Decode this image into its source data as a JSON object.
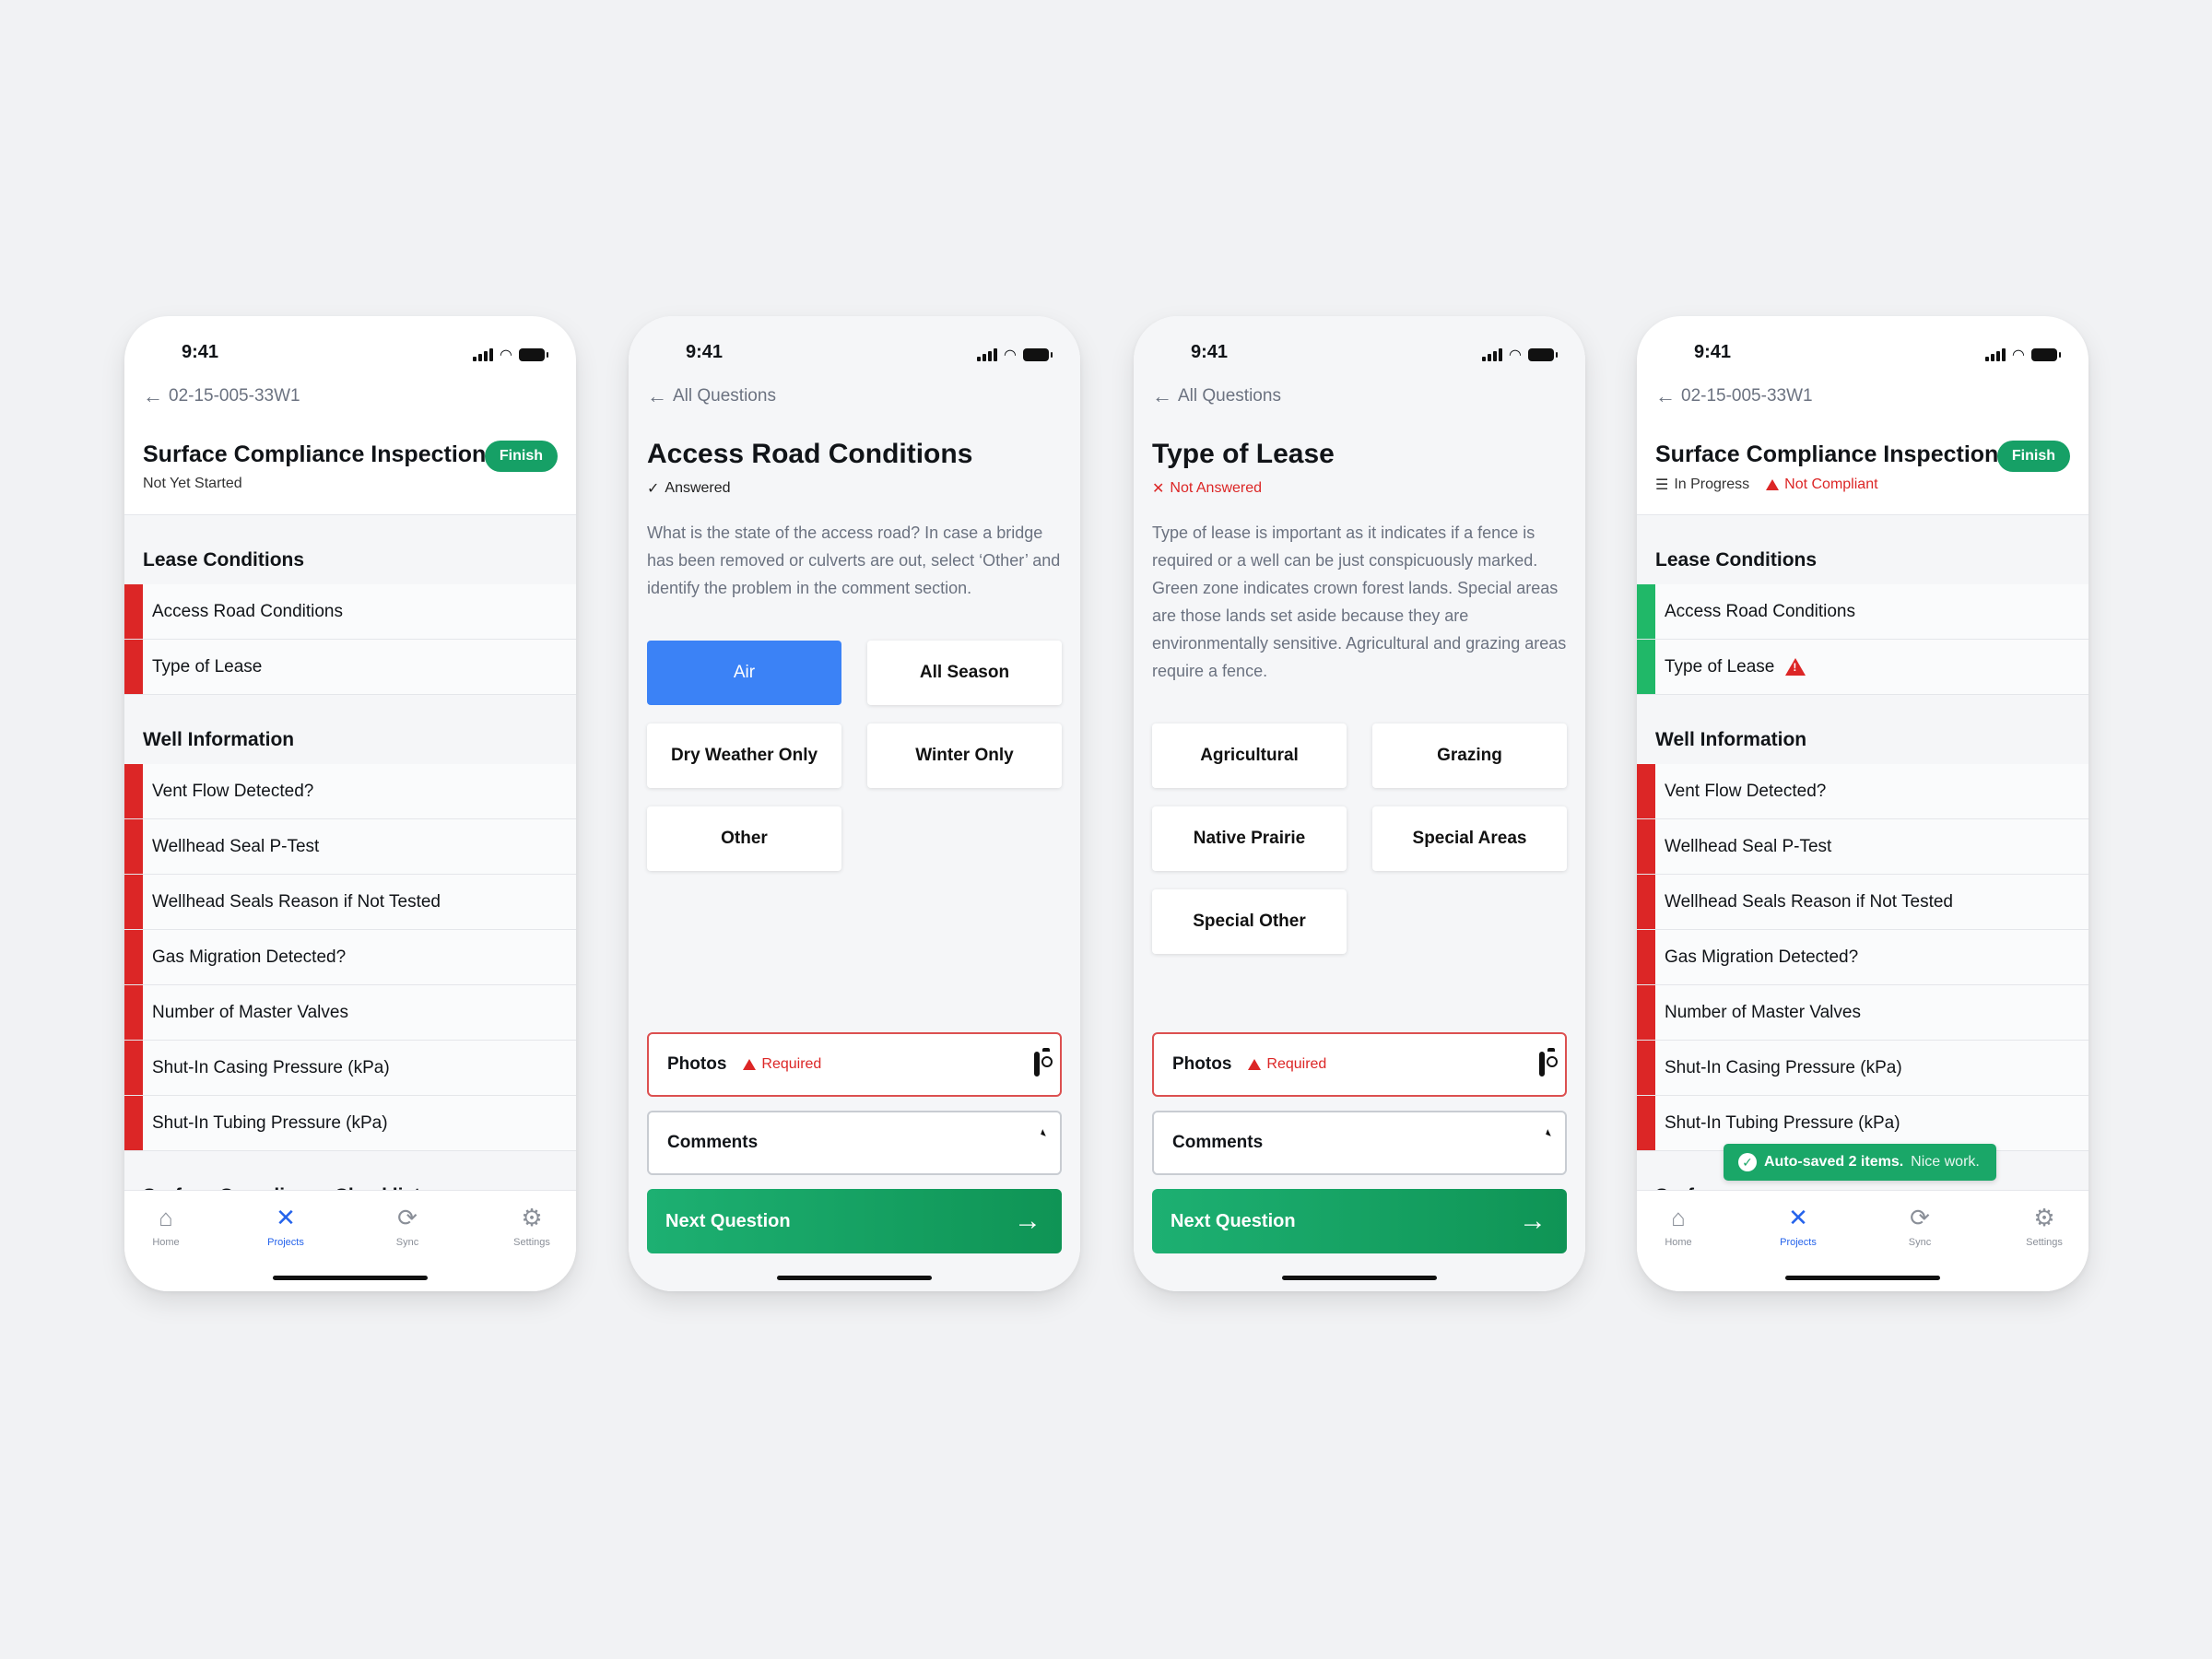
{
  "status_time": "9:41",
  "colors": {
    "accent_green": "#16a066",
    "fail_red": "#dc2626",
    "ok_green": "#20b868",
    "select_blue": "#3b82f6",
    "active_tab_blue": "#2563eb"
  },
  "tabs": [
    {
      "label": "Home",
      "icon": "home-icon"
    },
    {
      "label": "Projects",
      "icon": "tools-icon"
    },
    {
      "label": "Sync",
      "icon": "sync-icon"
    },
    {
      "label": "Settings",
      "icon": "gear-icon"
    }
  ],
  "screen1": {
    "back": "02-15-005-33W1",
    "title": "Surface Compliance Inspection",
    "finish": "Finish",
    "status": "Not Yet Started",
    "sections": [
      {
        "title": "Lease Conditions",
        "items": [
          {
            "label": "Access Road Conditions",
            "state": "red"
          },
          {
            "label": "Type of Lease",
            "state": "red"
          }
        ]
      },
      {
        "title": "Well Information",
        "items": [
          {
            "label": "Vent Flow Detected?",
            "state": "red"
          },
          {
            "label": "Wellhead Seal P-Test",
            "state": "red"
          },
          {
            "label": "Wellhead Seals Reason if Not Tested",
            "state": "red"
          },
          {
            "label": "Gas Migration Detected?",
            "state": "red"
          },
          {
            "label": "Number of Master Valves",
            "state": "red"
          },
          {
            "label": "Shut-In Casing Pressure (kPa)",
            "state": "red"
          },
          {
            "label": "Shut-In Tubing Pressure (kPa)",
            "state": "red"
          }
        ]
      },
      {
        "title": "Surface Compliance Checklist",
        "items": []
      }
    ]
  },
  "screen2": {
    "back": "All Questions",
    "title": "Access Road Conditions",
    "status": "Answered",
    "description": "What is the state of the access road? In case a bridge has been removed or culverts are out, select ‘Other’ and identify the problem in the comment section.",
    "options": [
      "Air",
      "All Season",
      "Dry Weather Only",
      "Winter Only",
      "Other"
    ],
    "selected": "Air",
    "photos_label": "Photos",
    "required_label": "Required",
    "comments_label": "Comments",
    "next_label": "Next Question"
  },
  "screen3": {
    "back": "All Questions",
    "title": "Type of Lease",
    "status": "Not Answered",
    "description": "Type of lease is important as it indicates if a fence is required or a well can be just conspicuously marked. Green zone indicates crown forest lands. Special areas are those lands set aside because they are environmentally sensitive. Agricultural and grazing areas require a fence.",
    "options": [
      "Agricultural",
      "Grazing",
      "Native Prairie",
      "Special Areas",
      "Special Other"
    ],
    "photos_label": "Photos",
    "required_label": "Required",
    "comments_label": "Comments",
    "next_label": "Next Question"
  },
  "screen4": {
    "back": "02-15-005-33W1",
    "title": "Surface Compliance Inspection",
    "finish": "Finish",
    "status_progress": "In Progress",
    "status_compliance": "Not Compliant",
    "sections": [
      {
        "title": "Lease Conditions",
        "items": [
          {
            "label": "Access Road Conditions",
            "state": "green"
          },
          {
            "label": "Type of Lease",
            "state": "green",
            "warning": true
          }
        ]
      },
      {
        "title": "Well Information",
        "items": [
          {
            "label": "Vent Flow Detected?",
            "state": "red"
          },
          {
            "label": "Wellhead Seal P-Test",
            "state": "red"
          },
          {
            "label": "Wellhead Seals Reason if Not Tested",
            "state": "red"
          },
          {
            "label": "Gas Migration Detected?",
            "state": "red"
          },
          {
            "label": "Number of Master Valves",
            "state": "red"
          },
          {
            "label": "Shut-In Casing Pressure (kPa)",
            "state": "red"
          },
          {
            "label": "Shut-In Tubing Pressure (kPa)",
            "state": "red"
          }
        ]
      },
      {
        "title": "Surface",
        "items": []
      }
    ],
    "toast_bold": "Auto-saved 2 items.",
    "toast_rest": "Nice work."
  }
}
